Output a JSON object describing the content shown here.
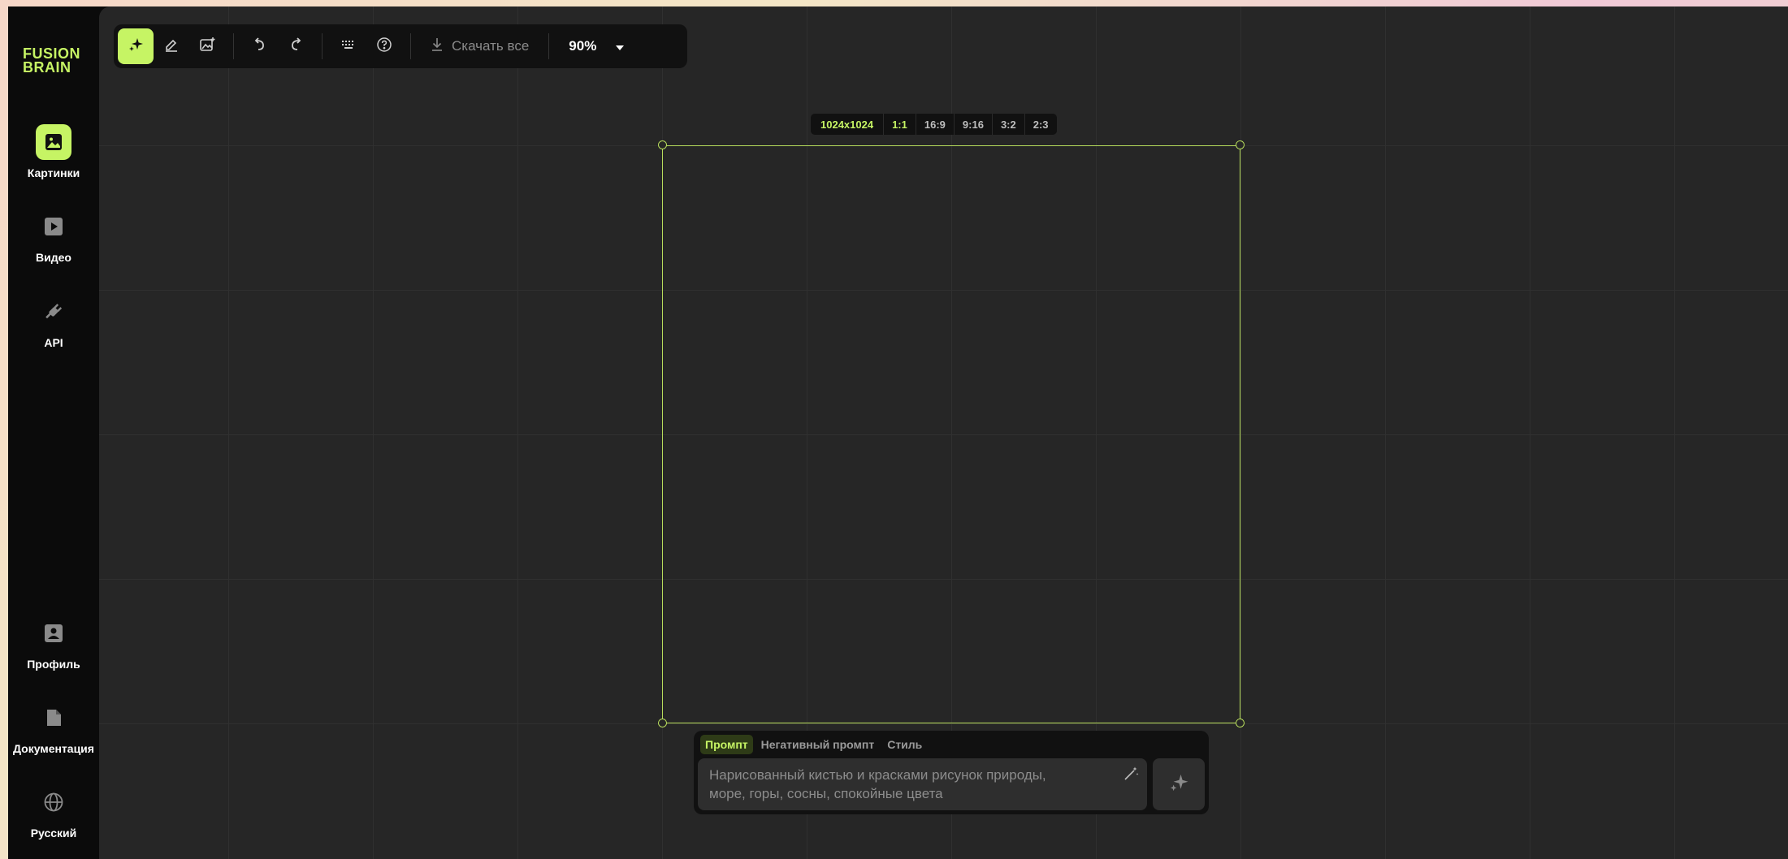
{
  "brand": {
    "line1": "FUSION",
    "line2": "BRAIN",
    "color": "#c6f464"
  },
  "sidebar": {
    "top_items": [
      {
        "label": "Картинки",
        "icon": "image-icon",
        "active": true
      },
      {
        "label": "Видео",
        "icon": "play-icon",
        "active": false
      },
      {
        "label": "API",
        "icon": "plug-icon",
        "active": false
      }
    ],
    "bottom_items": [
      {
        "label": "Профиль",
        "icon": "profile-icon"
      },
      {
        "label": "Документация",
        "icon": "document-icon"
      },
      {
        "label": "Русский",
        "icon": "globe-icon"
      }
    ]
  },
  "toolbar": {
    "tools": [
      "sparkle-icon",
      "eraser-icon",
      "image-edit-icon"
    ],
    "undo_icon": "undo-icon",
    "redo_icon": "redo-icon",
    "keyboard_icon": "keyboard-icon",
    "help_icon": "help-icon",
    "download_label": "Скачать все",
    "zoom": "90%"
  },
  "canvas": {
    "size_label": "1024x1024",
    "ratios": [
      "1:1",
      "16:9",
      "9:16",
      "3:2",
      "2:3"
    ],
    "active_ratio": "1:1"
  },
  "prompt": {
    "tabs": [
      "Промпт",
      "Негативный промпт",
      "Стиль"
    ],
    "active_tab": "Промпт",
    "placeholder_line1": "Нарисованный кистью и красками рисунок природы,",
    "placeholder_line2": "море, горы, сосны, спокойные цвета"
  },
  "colors": {
    "accent": "#c6f464",
    "frame": "#b7dc5c",
    "canvas_bg": "#262626"
  }
}
